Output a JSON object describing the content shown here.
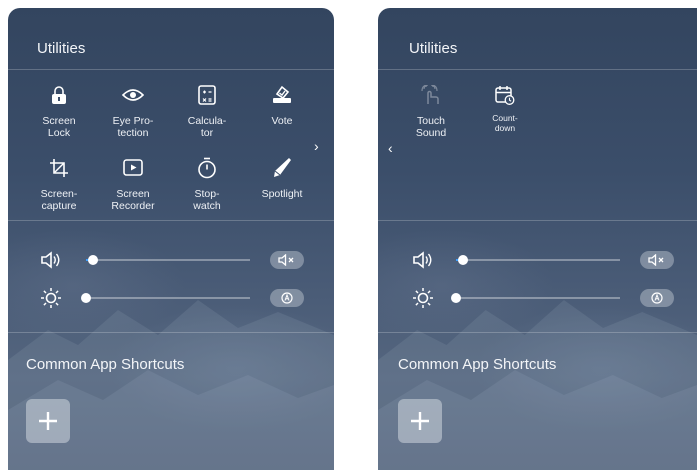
{
  "left": {
    "title": "Utilities",
    "tools": [
      {
        "icon": "screen-lock-icon",
        "label": "Screen\nLock"
      },
      {
        "icon": "eye-protection-icon",
        "label": "Eye Pro-\ntection"
      },
      {
        "icon": "calculator-icon",
        "label": "Calcula-\ntor"
      },
      {
        "icon": "vote-icon",
        "label": "Vote"
      },
      {
        "icon": "screen-capture-icon",
        "label": "Screen-\ncapture"
      },
      {
        "icon": "screen-recorder-icon",
        "label": "Screen\nRecorder"
      },
      {
        "icon": "stopwatch-icon",
        "label": "Stop-\nwatch"
      },
      {
        "icon": "spotlight-icon",
        "label": "Spotlight"
      }
    ],
    "next_arrow": "›",
    "volume": {
      "level": 0.04
    },
    "brightness": {
      "level": 0.0
    },
    "shortcuts_title": "Common App Shortcuts",
    "add_label": "+"
  },
  "right": {
    "title": "Utilities",
    "tools": [
      {
        "icon": "touch-sound-icon",
        "label": "Touch\nSound"
      },
      {
        "icon": "countdown-icon",
        "label": "Count-\ndown"
      }
    ],
    "prev_arrow": "‹",
    "volume": {
      "level": 0.04
    },
    "brightness": {
      "level": 0.0
    },
    "shortcuts_title": "Common App Shortcuts",
    "add_label": "+"
  },
  "colors": {
    "accent": "#3ea0ff",
    "panel_top": "#33455f",
    "panel_bottom": "#4e5e76"
  }
}
